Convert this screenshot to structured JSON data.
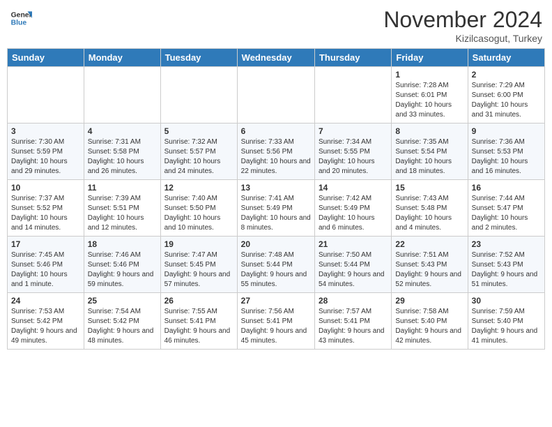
{
  "header": {
    "logo": {
      "line1": "General",
      "line2": "Blue"
    },
    "title": "November 2024",
    "location": "Kizilcasogut, Turkey"
  },
  "weekdays": [
    "Sunday",
    "Monday",
    "Tuesday",
    "Wednesday",
    "Thursday",
    "Friday",
    "Saturday"
  ],
  "weeks": [
    [
      {
        "day": "",
        "info": ""
      },
      {
        "day": "",
        "info": ""
      },
      {
        "day": "",
        "info": ""
      },
      {
        "day": "",
        "info": ""
      },
      {
        "day": "",
        "info": ""
      },
      {
        "day": "1",
        "info": "Sunrise: 7:28 AM\nSunset: 6:01 PM\nDaylight: 10 hours and 33 minutes."
      },
      {
        "day": "2",
        "info": "Sunrise: 7:29 AM\nSunset: 6:00 PM\nDaylight: 10 hours and 31 minutes."
      }
    ],
    [
      {
        "day": "3",
        "info": "Sunrise: 7:30 AM\nSunset: 5:59 PM\nDaylight: 10 hours and 29 minutes."
      },
      {
        "day": "4",
        "info": "Sunrise: 7:31 AM\nSunset: 5:58 PM\nDaylight: 10 hours and 26 minutes."
      },
      {
        "day": "5",
        "info": "Sunrise: 7:32 AM\nSunset: 5:57 PM\nDaylight: 10 hours and 24 minutes."
      },
      {
        "day": "6",
        "info": "Sunrise: 7:33 AM\nSunset: 5:56 PM\nDaylight: 10 hours and 22 minutes."
      },
      {
        "day": "7",
        "info": "Sunrise: 7:34 AM\nSunset: 5:55 PM\nDaylight: 10 hours and 20 minutes."
      },
      {
        "day": "8",
        "info": "Sunrise: 7:35 AM\nSunset: 5:54 PM\nDaylight: 10 hours and 18 minutes."
      },
      {
        "day": "9",
        "info": "Sunrise: 7:36 AM\nSunset: 5:53 PM\nDaylight: 10 hours and 16 minutes."
      }
    ],
    [
      {
        "day": "10",
        "info": "Sunrise: 7:37 AM\nSunset: 5:52 PM\nDaylight: 10 hours and 14 minutes."
      },
      {
        "day": "11",
        "info": "Sunrise: 7:39 AM\nSunset: 5:51 PM\nDaylight: 10 hours and 12 minutes."
      },
      {
        "day": "12",
        "info": "Sunrise: 7:40 AM\nSunset: 5:50 PM\nDaylight: 10 hours and 10 minutes."
      },
      {
        "day": "13",
        "info": "Sunrise: 7:41 AM\nSunset: 5:49 PM\nDaylight: 10 hours and 8 minutes."
      },
      {
        "day": "14",
        "info": "Sunrise: 7:42 AM\nSunset: 5:49 PM\nDaylight: 10 hours and 6 minutes."
      },
      {
        "day": "15",
        "info": "Sunrise: 7:43 AM\nSunset: 5:48 PM\nDaylight: 10 hours and 4 minutes."
      },
      {
        "day": "16",
        "info": "Sunrise: 7:44 AM\nSunset: 5:47 PM\nDaylight: 10 hours and 2 minutes."
      }
    ],
    [
      {
        "day": "17",
        "info": "Sunrise: 7:45 AM\nSunset: 5:46 PM\nDaylight: 10 hours and 1 minute."
      },
      {
        "day": "18",
        "info": "Sunrise: 7:46 AM\nSunset: 5:46 PM\nDaylight: 9 hours and 59 minutes."
      },
      {
        "day": "19",
        "info": "Sunrise: 7:47 AM\nSunset: 5:45 PM\nDaylight: 9 hours and 57 minutes."
      },
      {
        "day": "20",
        "info": "Sunrise: 7:48 AM\nSunset: 5:44 PM\nDaylight: 9 hours and 55 minutes."
      },
      {
        "day": "21",
        "info": "Sunrise: 7:50 AM\nSunset: 5:44 PM\nDaylight: 9 hours and 54 minutes."
      },
      {
        "day": "22",
        "info": "Sunrise: 7:51 AM\nSunset: 5:43 PM\nDaylight: 9 hours and 52 minutes."
      },
      {
        "day": "23",
        "info": "Sunrise: 7:52 AM\nSunset: 5:43 PM\nDaylight: 9 hours and 51 minutes."
      }
    ],
    [
      {
        "day": "24",
        "info": "Sunrise: 7:53 AM\nSunset: 5:42 PM\nDaylight: 9 hours and 49 minutes."
      },
      {
        "day": "25",
        "info": "Sunrise: 7:54 AM\nSunset: 5:42 PM\nDaylight: 9 hours and 48 minutes."
      },
      {
        "day": "26",
        "info": "Sunrise: 7:55 AM\nSunset: 5:41 PM\nDaylight: 9 hours and 46 minutes."
      },
      {
        "day": "27",
        "info": "Sunrise: 7:56 AM\nSunset: 5:41 PM\nDaylight: 9 hours and 45 minutes."
      },
      {
        "day": "28",
        "info": "Sunrise: 7:57 AM\nSunset: 5:41 PM\nDaylight: 9 hours and 43 minutes."
      },
      {
        "day": "29",
        "info": "Sunrise: 7:58 AM\nSunset: 5:40 PM\nDaylight: 9 hours and 42 minutes."
      },
      {
        "day": "30",
        "info": "Sunrise: 7:59 AM\nSunset: 5:40 PM\nDaylight: 9 hours and 41 minutes."
      }
    ]
  ]
}
